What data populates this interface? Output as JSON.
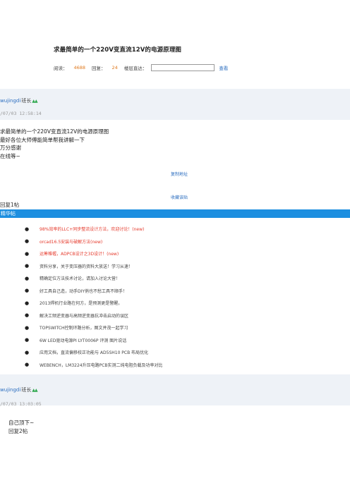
{
  "thread": {
    "title": "求最简单的一个220V变直流12V的电源原理图",
    "views_label": "阅读：",
    "views": "4688",
    "replies_label": "回复：",
    "replies": "24",
    "jump_label": "楼层直达：",
    "jump_value": "",
    "jump_button": "查看"
  },
  "posts": [
    {
      "author": "wujingdi",
      "rank": "班长",
      "rank_icon": "triangles-icon",
      "date": "/07/03 12:58:14",
      "lines": [
        "求最简单的一个220V变直流12V的电源原理图",
        "最好各位大师傅能简单帮我讲解一下",
        "万分感谢",
        "在线等~"
      ],
      "copy_link": "复制地址",
      "fav_link": "收藏该贴",
      "reply_no": "回复1帖"
    },
    {
      "author": "wujingdi",
      "rank": "班长",
      "rank_icon": "triangles-icon",
      "date": "/07/03 13:03:05",
      "lines": [
        "自己顶下~"
      ],
      "reply_no": "回复2帖"
    }
  ],
  "featured": {
    "header": "精华帖",
    "items": [
      {
        "text": "98%效率的LLC+同步整流设计方法，欢迎讨论！(new)",
        "red": true
      },
      {
        "text": "orcad16.5安装与破解方法(new)",
        "red": true
      },
      {
        "text": "运筹帷幄，ADPCB设计之3D设计！(new)",
        "red": true
      },
      {
        "text": "资料分享，关于变压器的资料大放送！学习从速！",
        "red": false
      },
      {
        "text": "精确定位方法技术讨论，请加入讨论大营！",
        "red": false
      },
      {
        "text": "好工具自己造，动手DIY俏也不愁工具不顺手！",
        "red": false
      },
      {
        "text": "2013焊机行业路在何方，是预测更是警醒。",
        "red": false
      },
      {
        "text": "解决工频逆变器与高频逆变器抗冲击启动的误区",
        "red": false
      },
      {
        "text": "TOPSWITCH控制环路分析，图文并茂一起学习",
        "red": false
      },
      {
        "text": "6W LED驱动电源PI LYT0006P 评测 图片说话",
        "red": false
      },
      {
        "text": "应用文档，直流偏移校正功能与 AD5SH10 PCB 布局优化",
        "red": false
      },
      {
        "text": "WEBENCH，LM3224升压电路PCB实测二纯电阻负载及功率对比",
        "red": false
      }
    ]
  },
  "colors": {
    "accent": "#1d8fe0",
    "link": "#2d6fc0",
    "count": "#e07a1f",
    "highlight": "#e5392b",
    "rank_icon": "#2fa84f"
  }
}
